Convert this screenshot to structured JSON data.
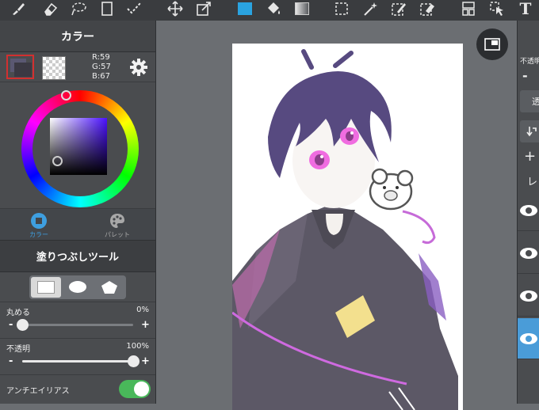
{
  "toolbar": {
    "icons": [
      "brush-icon",
      "eraser-icon",
      "lasso-icon",
      "canvas-icon",
      "select-check-icon",
      "move-icon",
      "transform-icon",
      "color-swatch-icon",
      "bucket-icon",
      "gradient-icon",
      "marquee-icon",
      "magic-wand-icon",
      "select-pen-icon",
      "select-eraser-icon",
      "layers-grid-icon",
      "pointer-icon",
      "text-tool-icon"
    ],
    "accent_color": "#2aa3e0",
    "text_tool_label": "T"
  },
  "color_panel": {
    "title": "カラー",
    "rgb": {
      "r": "R:59",
      "g": "G:57",
      "b": "B:67"
    },
    "current_color": "#3b3943",
    "tabs": [
      {
        "label": "カラー",
        "icon": "color-circle-icon",
        "active": true
      },
      {
        "label": "パレット",
        "icon": "palette-icon",
        "active": false
      }
    ]
  },
  "tool_panel": {
    "title": "塗りつぶしツール",
    "shapes": [
      {
        "name": "rectangle",
        "active": true
      },
      {
        "name": "ellipse",
        "active": false
      },
      {
        "name": "polygon",
        "active": false
      }
    ],
    "rounding": {
      "label": "丸める",
      "value": "0%",
      "fraction": 0.0,
      "minus": "-",
      "plus": "+"
    },
    "opacity": {
      "label": "不透明",
      "value": "100%",
      "fraction": 1.0,
      "minus": "-",
      "plus": "+"
    },
    "antialias": {
      "label": "アンチエイリアス",
      "on": true
    }
  },
  "right_panel": {
    "opacity_label": "不透明",
    "minus": "-",
    "blend_label": "透",
    "add": "+",
    "layer_label": "レ",
    "layers_visible": [
      true,
      true,
      true,
      true
    ],
    "selected_layer_color": "#4a9cd8"
  }
}
